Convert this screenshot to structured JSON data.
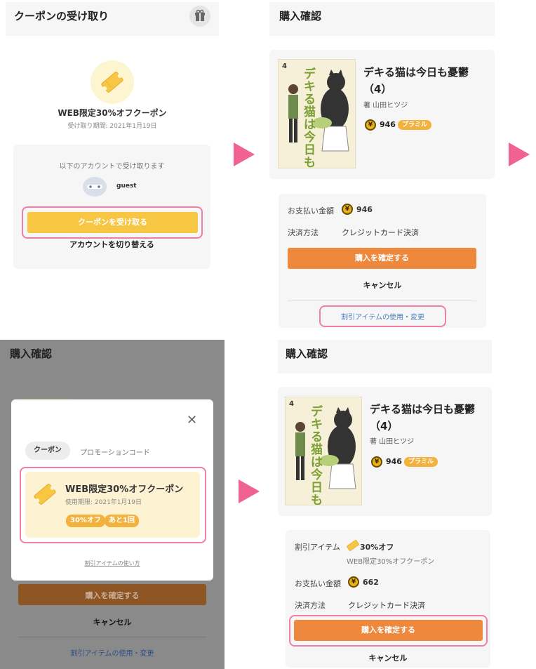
{
  "panel1": {
    "title": "クーポンの受け取り",
    "coupon_name": "WEB限定30%オフクーポン",
    "period": "受け取り期間: 2021年1月19日",
    "account_prompt": "以下のアカウントで受け取ります",
    "user_name": "guest",
    "receive_button": "クーポンを受け取る",
    "switch_account": "アカウントを切り替える",
    "icons": [
      "gift-icon",
      "ticket-icon",
      "avatar"
    ]
  },
  "panel2": {
    "title": "購入確認",
    "book_title_line1": "デキる猫は今日も憂鬱",
    "book_title_line2": "（4）",
    "author": "著 山田ヒツジ",
    "price": "946",
    "plan_badge": "プラミル",
    "pay_label": "お支払い金額",
    "pay_amount": "946",
    "method_label": "決済方法",
    "method_value": "クレジットカード決済",
    "confirm_button": "購入を確定する",
    "cancel": "キャンセル",
    "discount_link": "割引アイテムの使用・変更",
    "cover_volume": "4",
    "cover_text": "デキる猫は今日も憂鬱"
  },
  "panel3": {
    "title": "購入確認",
    "tab_coupon": "クーポン",
    "tab_promo": "プロモーションコード",
    "close": "✕",
    "coupon_name": "WEB限定30%オフクーポン",
    "coupon_period": "使用期限: 2021年1月19日",
    "badge_discount": "30%オフ",
    "badge_remaining": "あと1回",
    "howto_link": "割引アイテムの使い方",
    "confirm_button": "購入を確定する",
    "cancel": "キャンセル",
    "discount_link": "割引アイテムの使用・変更"
  },
  "panel4": {
    "title": "購入確認",
    "book_title_line1": "デキる猫は今日も憂鬱",
    "book_title_line2": "（4）",
    "author": "著 山田ヒツジ",
    "price": "946",
    "plan_badge": "プラミル",
    "discount_label": "割引アイテム",
    "discount_value": "30%オフ",
    "discount_coupon": "WEB限定30%オフクーポン",
    "pay_label": "お支払い金額",
    "pay_amount": "662",
    "method_label": "決済方法",
    "method_value": "クレジットカード決済",
    "confirm_button": "購入を確定する",
    "cancel": "キャンセル",
    "cover_volume": "4",
    "cover_text": "デキる猫は今日も憂鬱"
  },
  "colors": {
    "accent_orange": "#ee883c",
    "accent_yellow": "#f7c744",
    "highlight_pink": "#ee7fa8",
    "arrow_pink": "#f06292",
    "link_blue": "#4a7fc1"
  },
  "coin_glyph": "¥"
}
